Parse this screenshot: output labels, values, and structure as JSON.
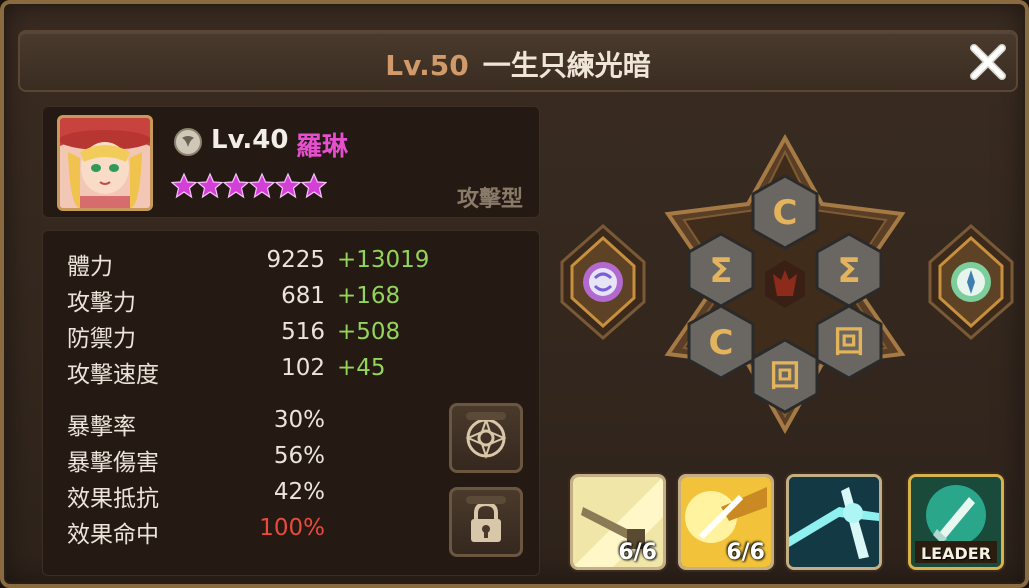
{
  "title": {
    "level": "Lv.50",
    "name": "一生只練光暗"
  },
  "hero": {
    "level": "Lv.40",
    "name": "羅琳",
    "stars": 6,
    "type": "攻擊型",
    "star_color": "#d43fd8"
  },
  "stats": [
    {
      "label": "體力",
      "base": "9225",
      "bonus": "+13019"
    },
    {
      "label": "攻擊力",
      "base": "681",
      "bonus": "+168"
    },
    {
      "label": "防禦力",
      "base": "516",
      "bonus": "+508"
    },
    {
      "label": "攻擊速度",
      "base": "102",
      "bonus": "+45"
    },
    {
      "label": "暴擊率",
      "base": "30%",
      "bonus": ""
    },
    {
      "label": "暴擊傷害",
      "base": "56%",
      "bonus": ""
    },
    {
      "label": "效果抵抗",
      "base": "42%",
      "bonus": ""
    },
    {
      "label": "效果命中",
      "base": "100%",
      "bonus": "",
      "highlight": "#e84a3c"
    }
  ],
  "skills": [
    {
      "count": "6/6",
      "icon": "skill-1-icon"
    },
    {
      "count": "6/6",
      "icon": "skill-2-icon"
    },
    {
      "count": "",
      "icon": "skill-3-icon"
    },
    {
      "count": "",
      "badge": "LEADER",
      "icon": "leader-skill-icon"
    }
  ],
  "side_buttons": [
    "rune-view-icon",
    "lock-icon"
  ],
  "colors": {
    "bonus": "#93d45a",
    "title_level": "#d19a6a",
    "name": "#e64fcf"
  }
}
